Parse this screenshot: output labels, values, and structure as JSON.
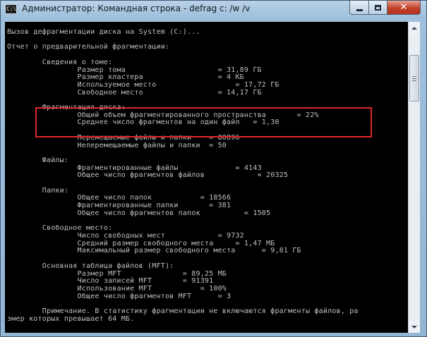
{
  "window": {
    "title": "Администратор: Командная строка - defrag  c: /w /v",
    "app_icon_label": "C:\\",
    "buttons": {
      "minimize_icon": "minimize-icon",
      "maximize_icon": "maximize-icon",
      "close_glyph": "✕"
    }
  },
  "console": {
    "lines": [
      "Вызов дефрагментации диска на System (C:)...",
      "",
      "Отчет о предварительной фрагментации:",
      "",
      "        Сведения о томе:",
      "                Размер тома                     = 31,89 ГБ",
      "                Размер кластера                 = 4 КБ",
      "                Используемое место                  = 17,72 ГБ",
      "                Свободное место                 = 14,17 ГБ",
      "",
      "        Фрагментация диска:",
      "                Общий объем фрагментированного пространства       = 22%",
      "                Среднее число фрагментов на один файл   = 1,30",
      "",
      "                Перемещаемые файлы и папки    = 88896",
      "                Неперемещаемые файлы и папки  = 50",
      "",
      "        Файлы:",
      "                Фрагментированные файлы             = 4143",
      "                Общее число фрагментов файлов            = 20325",
      "",
      "        Папки:",
      "                Общее число папок           = 18566",
      "                Фрагментированные папки       = 381",
      "                Общее число фрагментов папок          = 1505",
      "",
      "        Свободное место:",
      "                Число свободных мест            = 9732",
      "                Средний размер свободного места     = 1,47 МБ",
      "                Максимальный размер свободного места      = 9,81 ГБ",
      "",
      "        Основная таблица файлов (MFT):",
      "                Размер MFT              = 89,25 МБ",
      "                Число записей MFT       = 91391",
      "                Использование MFT           = 100%",
      "                Общее число фрагментов MFT      = 3",
      "",
      "        Примечание. В статистику фрагментации не включаются фрагменты файлов, ра",
      "змер которых превышает 64 МБ."
    ]
  },
  "highlight": {
    "color": "#e0262b",
    "covers": "Фрагментация диска"
  },
  "colors": {
    "console_bg": "#000000",
    "console_fg": "#c0c0c0",
    "frame": "#9ec0dc",
    "close_button": "#c2412b"
  }
}
